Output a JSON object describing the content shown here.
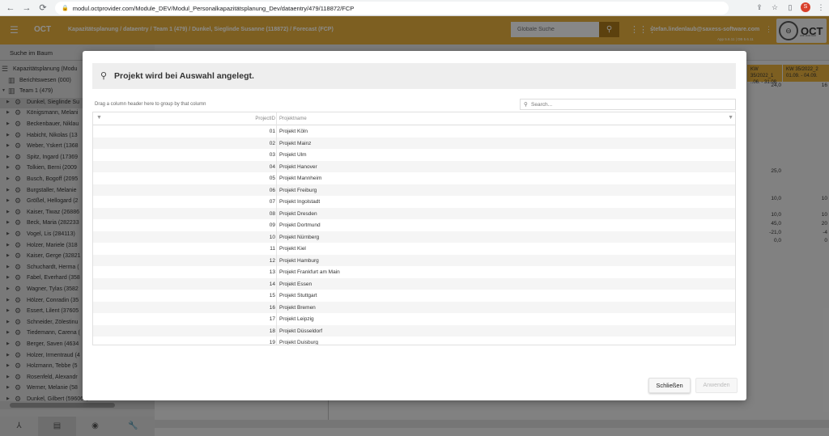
{
  "browser": {
    "url": "modul.octprovider.com/Module_DEV/Modul_Personalkapazitätsplanung_Dev/dataentry/479/118872/FCP",
    "profile_initial": "S"
  },
  "header": {
    "app_name": "OCT",
    "breadcrumb": "Kapazitätsplanung / dataentry / Team 1 (479) / Dunkel, Sieglinde Susanne (118872) / Forecast (FCP)",
    "search_placeholder": "Globale Suche",
    "user_email": "stefan.lindenlaub@saxess-software.com",
    "version": "App 5.6.11 | DB 5.6.11",
    "logo_text": "OCT",
    "logo_tagline": "one cool tool"
  },
  "sidebar": {
    "search_label": "Suche im Baum",
    "tree": [
      {
        "label": "Kapazitätsplanung (Modu",
        "icon": "db",
        "level": 0
      },
      {
        "label": "Berichtswesen (000)",
        "icon": "building",
        "level": 1
      },
      {
        "label": "Team 1 (479)",
        "icon": "building",
        "level": 1,
        "expanded": true
      },
      {
        "label": "Dunkel, Sieglinde Su",
        "icon": "gear",
        "level": 2,
        "selected": true
      },
      {
        "label": "Königsmann, Melani",
        "icon": "gear",
        "level": 2
      },
      {
        "label": "Beckenbauer, Niklau",
        "icon": "gear",
        "level": 2
      },
      {
        "label": "Habicht, Nikolas (13",
        "icon": "gear",
        "level": 2
      },
      {
        "label": "Weber, Yskert (1368",
        "icon": "gear",
        "level": 2
      },
      {
        "label": "Spitz, Ingard (17369",
        "icon": "gear",
        "level": 2
      },
      {
        "label": "Tolkien, Berni (2009",
        "icon": "gear",
        "level": 2
      },
      {
        "label": "Busch, Bogoff (2095",
        "icon": "gear",
        "level": 2
      },
      {
        "label": "Burgstaller, Melanie",
        "icon": "gear",
        "level": 2
      },
      {
        "label": "Größel, Hellogard (2",
        "icon": "gear",
        "level": 2
      },
      {
        "label": "Kaiser, Tiwaz (26886",
        "icon": "gear",
        "level": 2
      },
      {
        "label": "Beck, Maria (282233",
        "icon": "gear",
        "level": 2
      },
      {
        "label": "Vogel, Lis (284113)",
        "icon": "gear",
        "level": 2
      },
      {
        "label": "Holzer, Mariele (318",
        "icon": "gear",
        "level": 2
      },
      {
        "label": "Kaiser, Gerge (32821",
        "icon": "gear",
        "level": 2
      },
      {
        "label": "Schuchardt, Herma (",
        "icon": "gear",
        "level": 2
      },
      {
        "label": "Fabel, Everhard (358",
        "icon": "gear",
        "level": 2
      },
      {
        "label": "Wagner, Tylas (3582",
        "icon": "gear",
        "level": 2
      },
      {
        "label": "Hölzer, Conradin (35",
        "icon": "gear",
        "level": 2
      },
      {
        "label": "Essert, Lilent (37605",
        "icon": "gear",
        "level": 2
      },
      {
        "label": "Schneider, Zölestinu",
        "icon": "gear",
        "level": 2
      },
      {
        "label": "Tiedemann, Carena (",
        "icon": "gear",
        "level": 2
      },
      {
        "label": "Berger, Saven (4634",
        "icon": "gear",
        "level": 2
      },
      {
        "label": "Holzer, Irmentraud (4",
        "icon": "gear",
        "level": 2
      },
      {
        "label": "Holzmann, Tebbe (5",
        "icon": "gear",
        "level": 2
      },
      {
        "label": "Rosenfeld, Alexandr",
        "icon": "gear",
        "level": 2
      },
      {
        "label": "Werner, Melanie (58",
        "icon": "gear",
        "level": 2
      },
      {
        "label": "Dunkel, Gilbert (596066)",
        "icon": "gear",
        "level": 2
      }
    ]
  },
  "grid_bg": {
    "kw1_line1": "KW 35/2022_1",
    "kw1_line2": "..06. - 31.08.",
    "kw2_line1": "KW 35/2022_2",
    "kw2_line2": "01.09. - 04.09.",
    "cells": [
      {
        "v1": "24,0",
        "v2": "16",
        "row": 0
      },
      {
        "v1": "25,0",
        "v2": "",
        "row": 1
      },
      {
        "v1": "10,0",
        "v2": "10",
        "row": 2
      },
      {
        "v1": "10,0",
        "v2": "10",
        "row": 3
      },
      {
        "v1": "45,0",
        "v2": "20",
        "row": 4
      },
      {
        "v1": "-21,0",
        "v2": "-4",
        "row": 5
      },
      {
        "v1": "0,0",
        "v2": "0",
        "row": 6
      }
    ]
  },
  "modal": {
    "title": "Projekt wird bei Auswahl angelegt.",
    "group_hint": "Drag a column header here to group by that column",
    "search_placeholder": "Search...",
    "col_id": "ProjectID",
    "col_name": "Projektname",
    "rows": [
      {
        "id": "01",
        "name": "Projekt Köln"
      },
      {
        "id": "02",
        "name": "Projekt Mainz"
      },
      {
        "id": "03",
        "name": "Projekt Ulm"
      },
      {
        "id": "04",
        "name": "Projekt Hanover"
      },
      {
        "id": "05",
        "name": "Projekt Mannheim"
      },
      {
        "id": "06",
        "name": "Projekt Freiburg"
      },
      {
        "id": "07",
        "name": "Projekt Ingolstadt"
      },
      {
        "id": "08",
        "name": "Projekt Dresden"
      },
      {
        "id": "09",
        "name": "Projekt Dortmund"
      },
      {
        "id": "10",
        "name": "Projekt Nürnberg"
      },
      {
        "id": "11",
        "name": "Projekt Kiel"
      },
      {
        "id": "12",
        "name": "Projekt Hamburg"
      },
      {
        "id": "13",
        "name": "Projekt Frankfurt am Main"
      },
      {
        "id": "14",
        "name": "Projekt Essen"
      },
      {
        "id": "15",
        "name": "Projekt Stuttgart"
      },
      {
        "id": "16",
        "name": "Projekt Bremen"
      },
      {
        "id": "17",
        "name": "Projekt Leipzig"
      },
      {
        "id": "18",
        "name": "Projekt Düsseldorf"
      },
      {
        "id": "19",
        "name": "Projekt Duisburg"
      }
    ],
    "close_label": "Schließen",
    "apply_label": "Anwenden"
  }
}
